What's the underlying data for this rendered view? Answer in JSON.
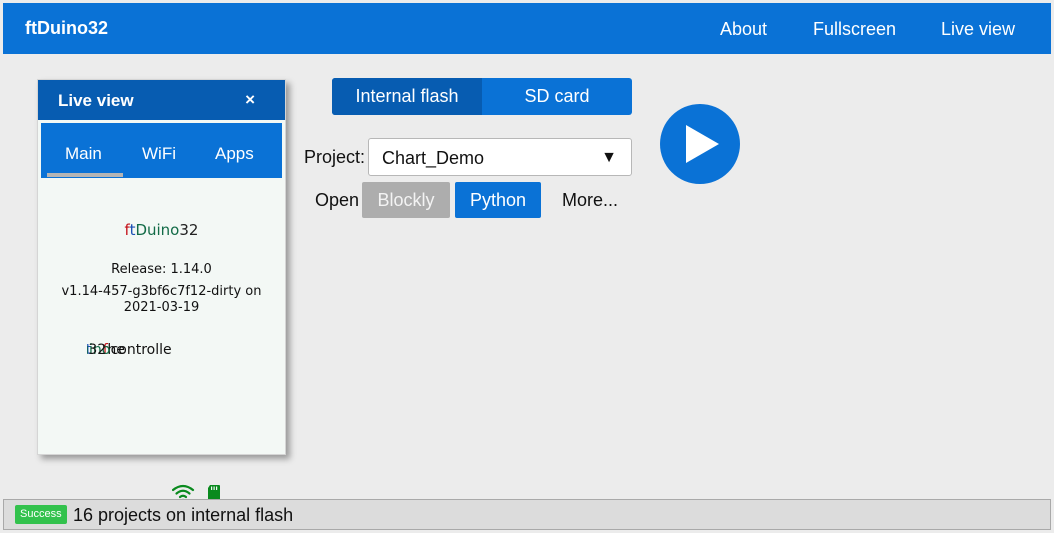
{
  "header": {
    "brand": "ftDuino32",
    "nav": [
      "About",
      "Fullscreen",
      "Live view"
    ]
  },
  "storage": {
    "tabs": [
      "Internal flash",
      "SD card"
    ],
    "selected": "Internal flash"
  },
  "project": {
    "label": "Project:",
    "selected": "Chart_Demo",
    "arrow": "▼"
  },
  "open": {
    "label": "Open",
    "buttons": [
      "Blockly",
      "Python"
    ],
    "more": "More..."
  },
  "run_button": {
    "icon": "play-icon"
  },
  "live_view": {
    "title": "Live view",
    "close": "×",
    "tabs": [
      "Main",
      "WiFi",
      "Apps"
    ],
    "active_tab": "Main",
    "logo": {
      "f": "f",
      "t": "t",
      "duino": "Duino",
      "num": "32"
    },
    "release": "Release: 1.14.0",
    "version": "v1.14-457-g3bf6c7f12-dirty on 2021-03-19",
    "marquee": {
      "pre": "he ",
      "f": "f",
      "t": "t",
      "duino": "Duino",
      "post": "32 controlle"
    },
    "icons": [
      "wifi-icon",
      "sd-card-icon"
    ],
    "accent_green": "#0a8a1e"
  },
  "status": {
    "badge": "Success",
    "message": "16 projects on internal flash"
  },
  "colors": {
    "primary": "#0a72d6",
    "primary_dark": "#075cb1",
    "success": "#33c24d"
  }
}
